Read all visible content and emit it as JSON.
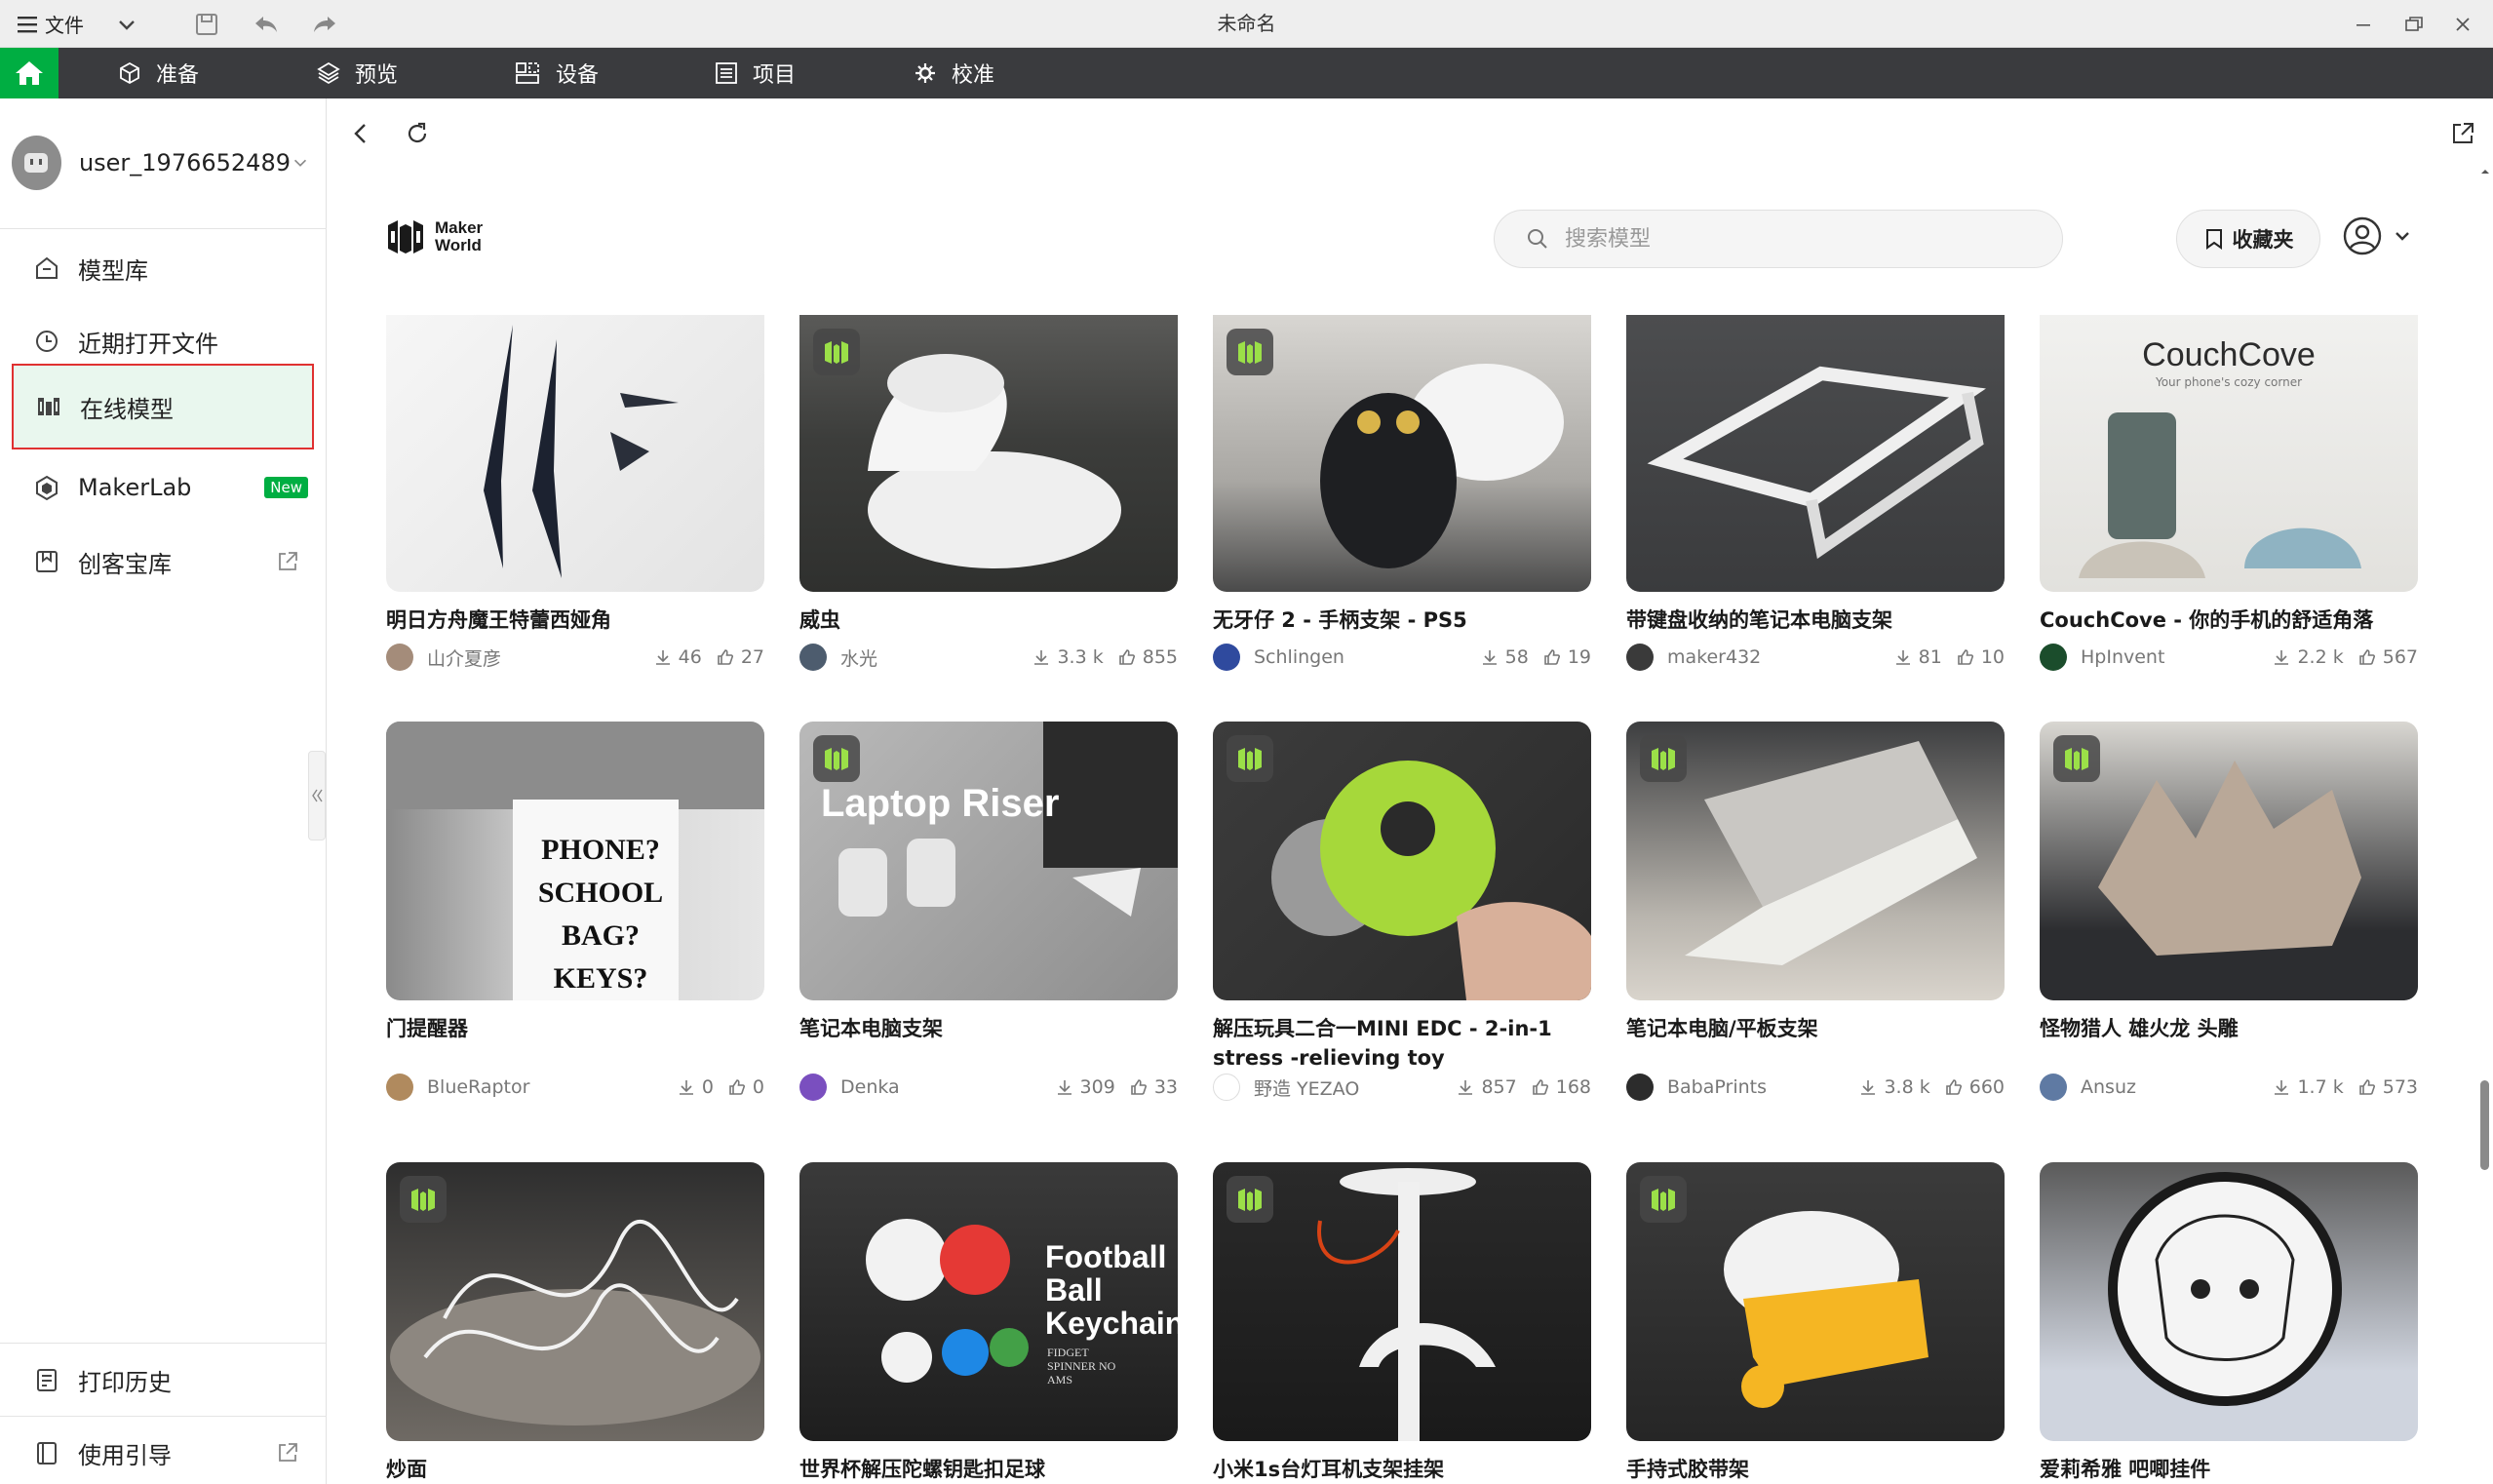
{
  "window": {
    "title": "未命名",
    "file_menu": "文件"
  },
  "nav": {
    "tabs": [
      {
        "label": "准备",
        "icon": "cube-icon"
      },
      {
        "label": "预览",
        "icon": "layers-icon"
      },
      {
        "label": "设备",
        "icon": "device-icon"
      },
      {
        "label": "项目",
        "icon": "list-icon"
      },
      {
        "label": "校准",
        "icon": "calibrate-icon"
      }
    ]
  },
  "sidebar": {
    "username": "user_1976652489",
    "items": [
      {
        "label": "模型库"
      },
      {
        "label": "近期打开文件"
      },
      {
        "label": "在线模型"
      },
      {
        "label": "MakerLab",
        "badge": "New"
      },
      {
        "label": "创客宝库"
      }
    ],
    "bottom": [
      {
        "label": "打印历史"
      },
      {
        "label": "使用引导"
      }
    ]
  },
  "site": {
    "logo_line1": "Maker",
    "logo_line2": "World",
    "search_placeholder": "搜索模型",
    "favorites_label": "收藏夹"
  },
  "colors": {
    "brand_green": "#00ae42",
    "nav_bg": "#3a3b3e",
    "active_border": "#e03131",
    "active_bg": "#e9f7ee"
  },
  "cards": [
    {
      "title": "明日方舟魔王特蕾西娅角",
      "author": "山介夏彦",
      "downloads": "46",
      "likes": "27"
    },
    {
      "title": "威虫",
      "author": "水光",
      "downloads": "3.3 k",
      "likes": "855"
    },
    {
      "title": "无牙仔 2 - 手柄支架 - PS5",
      "author": "Schlingen",
      "downloads": "58",
      "likes": "19"
    },
    {
      "title": "带键盘收纳的笔记本电脑支架",
      "author": "maker432",
      "downloads": "81",
      "likes": "10"
    },
    {
      "title": "CouchCove - 你的手机的舒适角落",
      "author": "HpInvent",
      "downloads": "2.2 k",
      "likes": "567",
      "thumb_text": "CouchCove",
      "thumb_sub": "Your phone's cozy corner"
    },
    {
      "title": "门提醒器",
      "author": "BlueRaptor",
      "downloads": "0",
      "likes": "0",
      "thumb_text": "PHONE? SCHOOL BAG? KEYS?"
    },
    {
      "title": "笔记本电脑支架",
      "author": "Denka",
      "downloads": "309",
      "likes": "33",
      "thumb_text": "Laptop Riser"
    },
    {
      "title": "解压玩具二合一MINI EDC - 2-in-1 stress -relieving toy",
      "author": "野造 YEZAO",
      "downloads": "857",
      "likes": "168"
    },
    {
      "title": "笔记本电脑/平板支架",
      "author": "BabaPrints",
      "downloads": "3.8 k",
      "likes": "660"
    },
    {
      "title": "怪物猎人 雄火龙 头雕",
      "author": "Ansuz",
      "downloads": "1.7 k",
      "likes": "573"
    },
    {
      "title": "炒面"
    },
    {
      "title": "世界杯解压陀螺钥匙扣足球",
      "thumb_text": "Football Ball Keychain",
      "thumb_sub": "FIDGET SPINNER NO AMS"
    },
    {
      "title": "小米1s台灯耳机支架挂架"
    },
    {
      "title": "手持式胶带架"
    },
    {
      "title": "爱莉希雅 吧唧挂件"
    }
  ]
}
